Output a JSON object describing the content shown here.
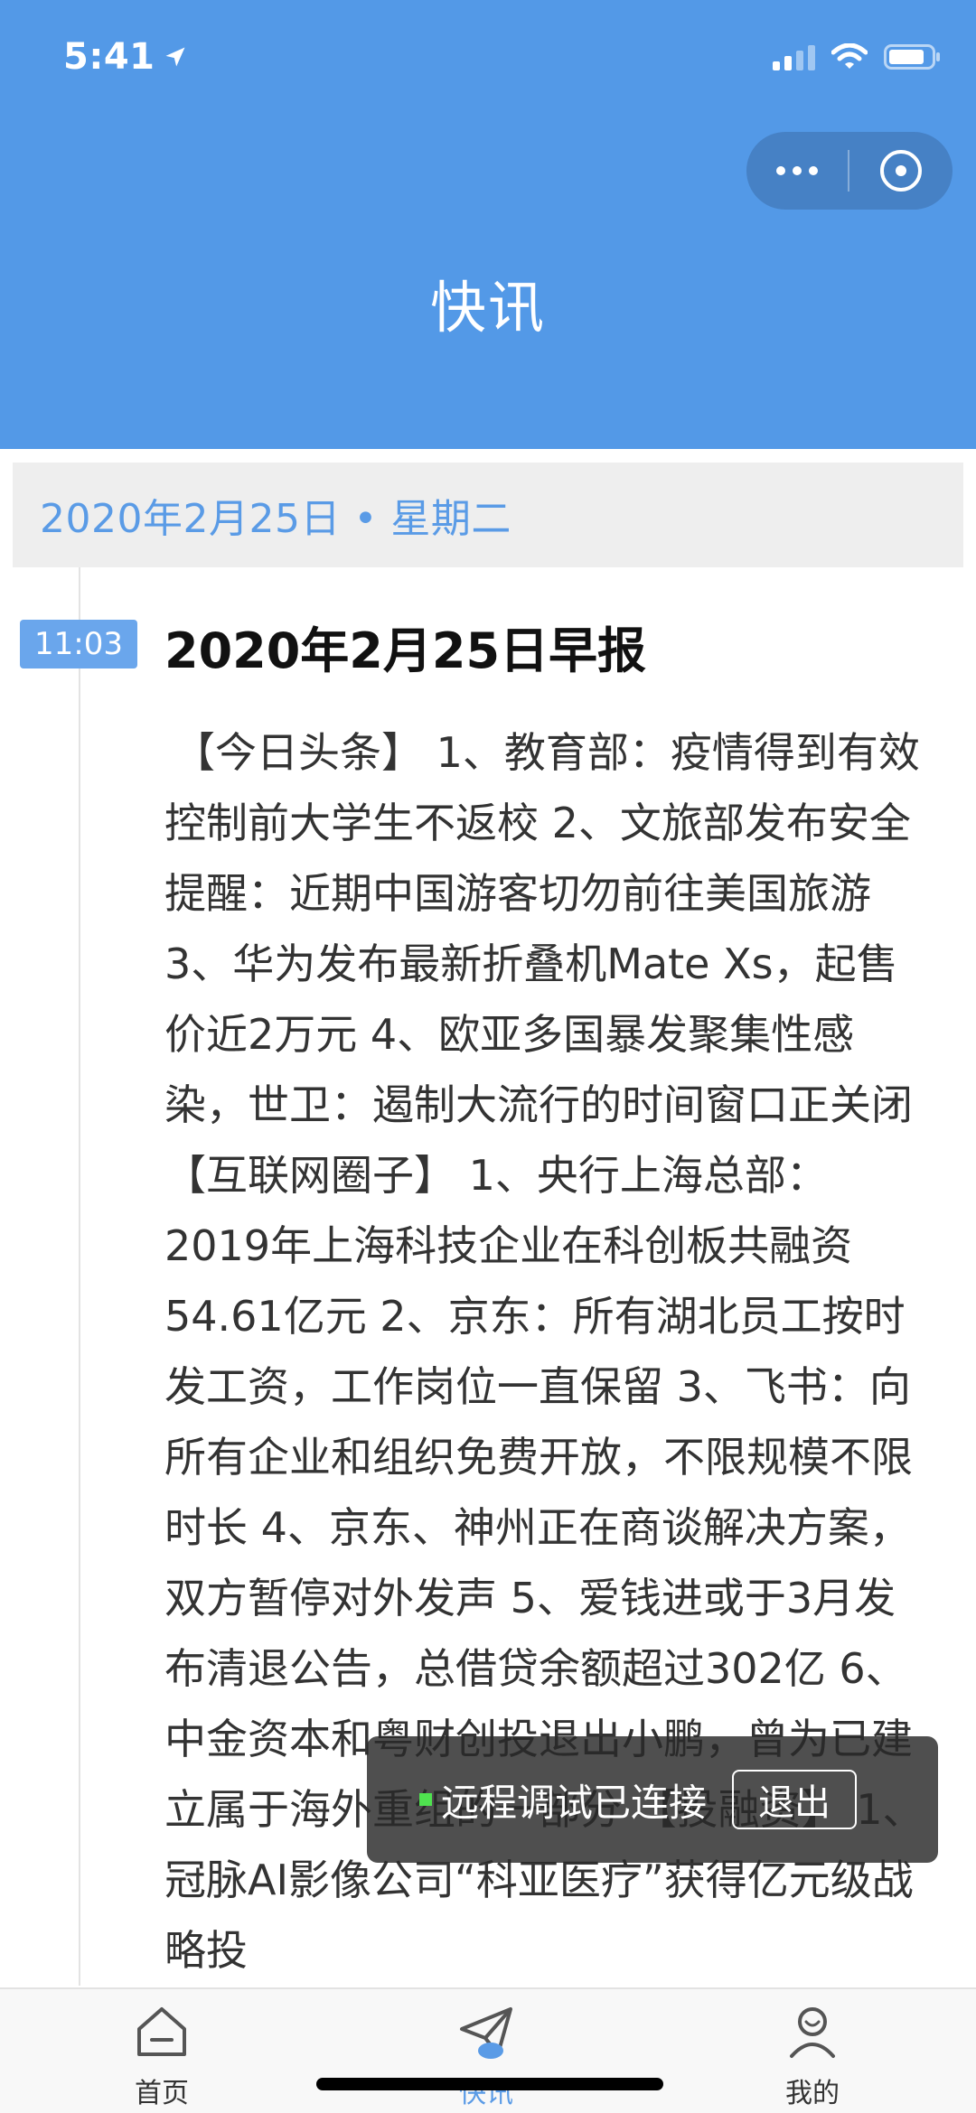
{
  "status_bar": {
    "time": "5:41"
  },
  "header": {
    "title": "快讯"
  },
  "date_bar": {
    "date": "2020年2月25日 • 星期二"
  },
  "news": {
    "time": "11:03",
    "title": "2020年2月25日早报",
    "body": "【今日头条】 1、教育部：疫情得到有效控制前大学生不返校 2、文旅部发布安全提醒：近期中国游客切勿前往美国旅游 3、华为发布最新折叠机Mate Xs，起售价近2万元 4、欧亚多国暴发聚集性感染，世卫：遏制大流行的时间窗口正关闭 【互联网圈子】 1、央行上海总部：2019年上海科技企业在科创板共融资54.61亿元 2、京东：所有湖北员工按时发工资，工作岗位一直保留 3、飞书：向所有企业和组织免费开放，不限规模不限时长 4、京东、神州正在商谈解决方案，双方暂停对外发声 5、爱钱进或于3月发布清退公告，总借贷余额超过302亿 6、中金资本和粤财创投退出小鹏，曾为已建立属于海外重组的一部分 【投融资】 1、冠脉AI影像公司“科亚医疗”获得亿元级战略投"
  },
  "toast": {
    "text": "远程调试已连接",
    "exit_label": "退出"
  },
  "tabbar": {
    "home_label": "首页",
    "news_label": "快讯",
    "mine_label": "我的"
  },
  "colors": {
    "header_bg": "#5399e7",
    "accent": "#5a9be6",
    "badge_bg": "#6aa6ec",
    "toast_dot": "#4fe24f"
  }
}
